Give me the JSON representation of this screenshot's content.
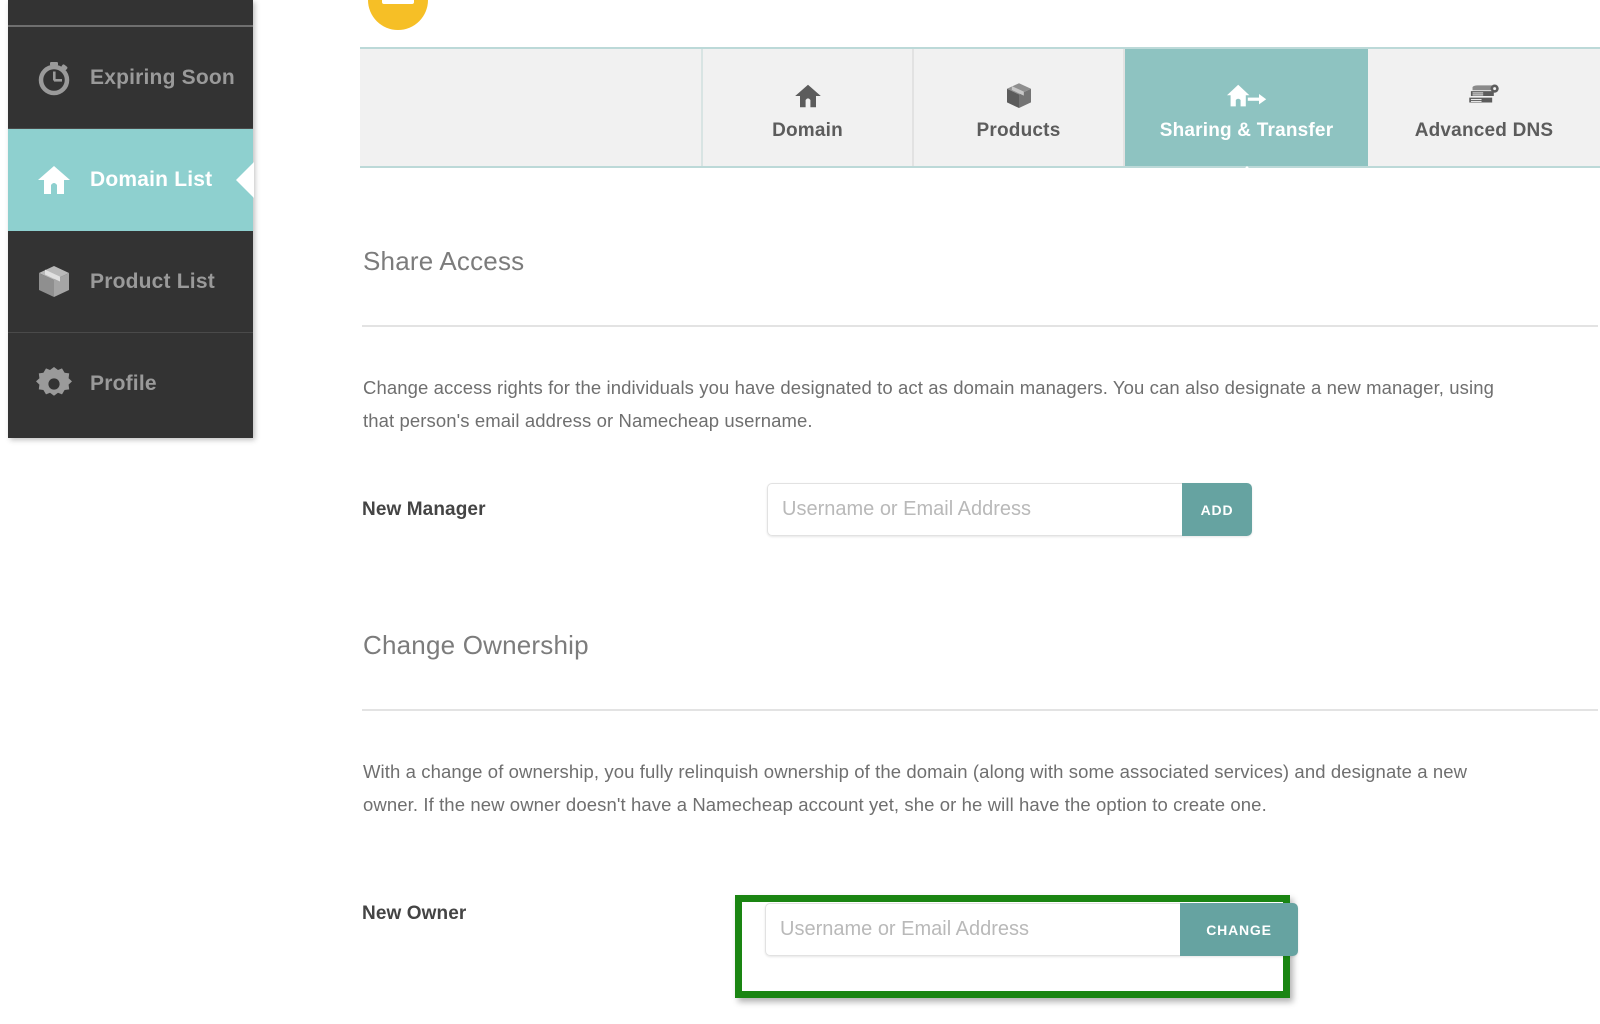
{
  "sidebar": {
    "items": [
      {
        "label": "",
        "icon": "partial-row",
        "active": false,
        "partial": true
      },
      {
        "label": "Expiring Soon",
        "icon": "stopwatch-icon",
        "active": false
      },
      {
        "label": "Domain List",
        "icon": "house-icon",
        "active": true
      },
      {
        "label": "Product List",
        "icon": "box-icon",
        "active": false
      },
      {
        "label": "Profile",
        "icon": "gear-icon",
        "active": false
      }
    ]
  },
  "badge": {
    "name": "yellow-status-badge",
    "color": "#f6bf26"
  },
  "tabs": [
    {
      "label": "",
      "icon": "",
      "active": false,
      "spacer": true
    },
    {
      "label": "Domain",
      "icon": "house-icon",
      "active": false
    },
    {
      "label": "Products",
      "icon": "box-icon",
      "active": false
    },
    {
      "label": "Sharing & Transfer",
      "icon": "house-arrow-icon",
      "active": true
    },
    {
      "label": "Advanced DNS",
      "icon": "server-gear-icon",
      "active": false
    }
  ],
  "share_access": {
    "title": "Share Access",
    "description": "Change access rights for the individuals you have designated to act as domain managers. You can also designate a new manager, using that person's email address or Namecheap username.",
    "field_label": "New Manager",
    "placeholder": "Username or Email Address",
    "value": "",
    "button_label": "ADD"
  },
  "change_ownership": {
    "title": "Change Ownership",
    "description": "With a change of ownership, you fully relinquish ownership of the domain (along with some associated services) and designate a new owner. If the new owner doesn't have a Namecheap account yet, she or he will have the option to create one.",
    "field_label": "New Owner",
    "placeholder": "Username or Email Address",
    "value": "",
    "button_label": "CHANGE"
  },
  "colors": {
    "sidebar_bg": "#333333",
    "sidebar_active": "#8ed0cf",
    "tab_active": "#8ec3c1",
    "button": "#66a3a1",
    "highlight_border": "#1a8512",
    "badge": "#f6bf26"
  }
}
